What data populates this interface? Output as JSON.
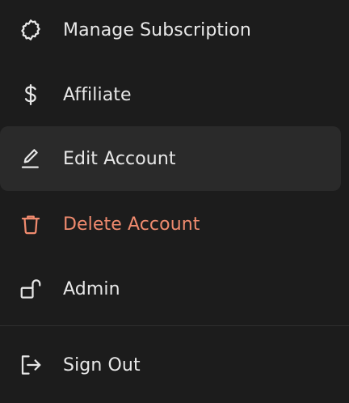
{
  "menu": {
    "items": [
      {
        "label": "Manage Subscription",
        "icon": "gear-icon"
      },
      {
        "label": "Affiliate",
        "icon": "dollar-icon"
      },
      {
        "label": "Edit Account",
        "icon": "pencil-icon"
      },
      {
        "label": "Delete Account",
        "icon": "trash-icon"
      },
      {
        "label": "Admin",
        "icon": "unlock-icon"
      },
      {
        "label": "Sign Out",
        "icon": "sign-out-icon"
      }
    ]
  },
  "colors": {
    "background": "#1c1c1c",
    "hover_background": "#2a2a2a",
    "text": "#e8e8e8",
    "danger": "#ef8a6e"
  }
}
